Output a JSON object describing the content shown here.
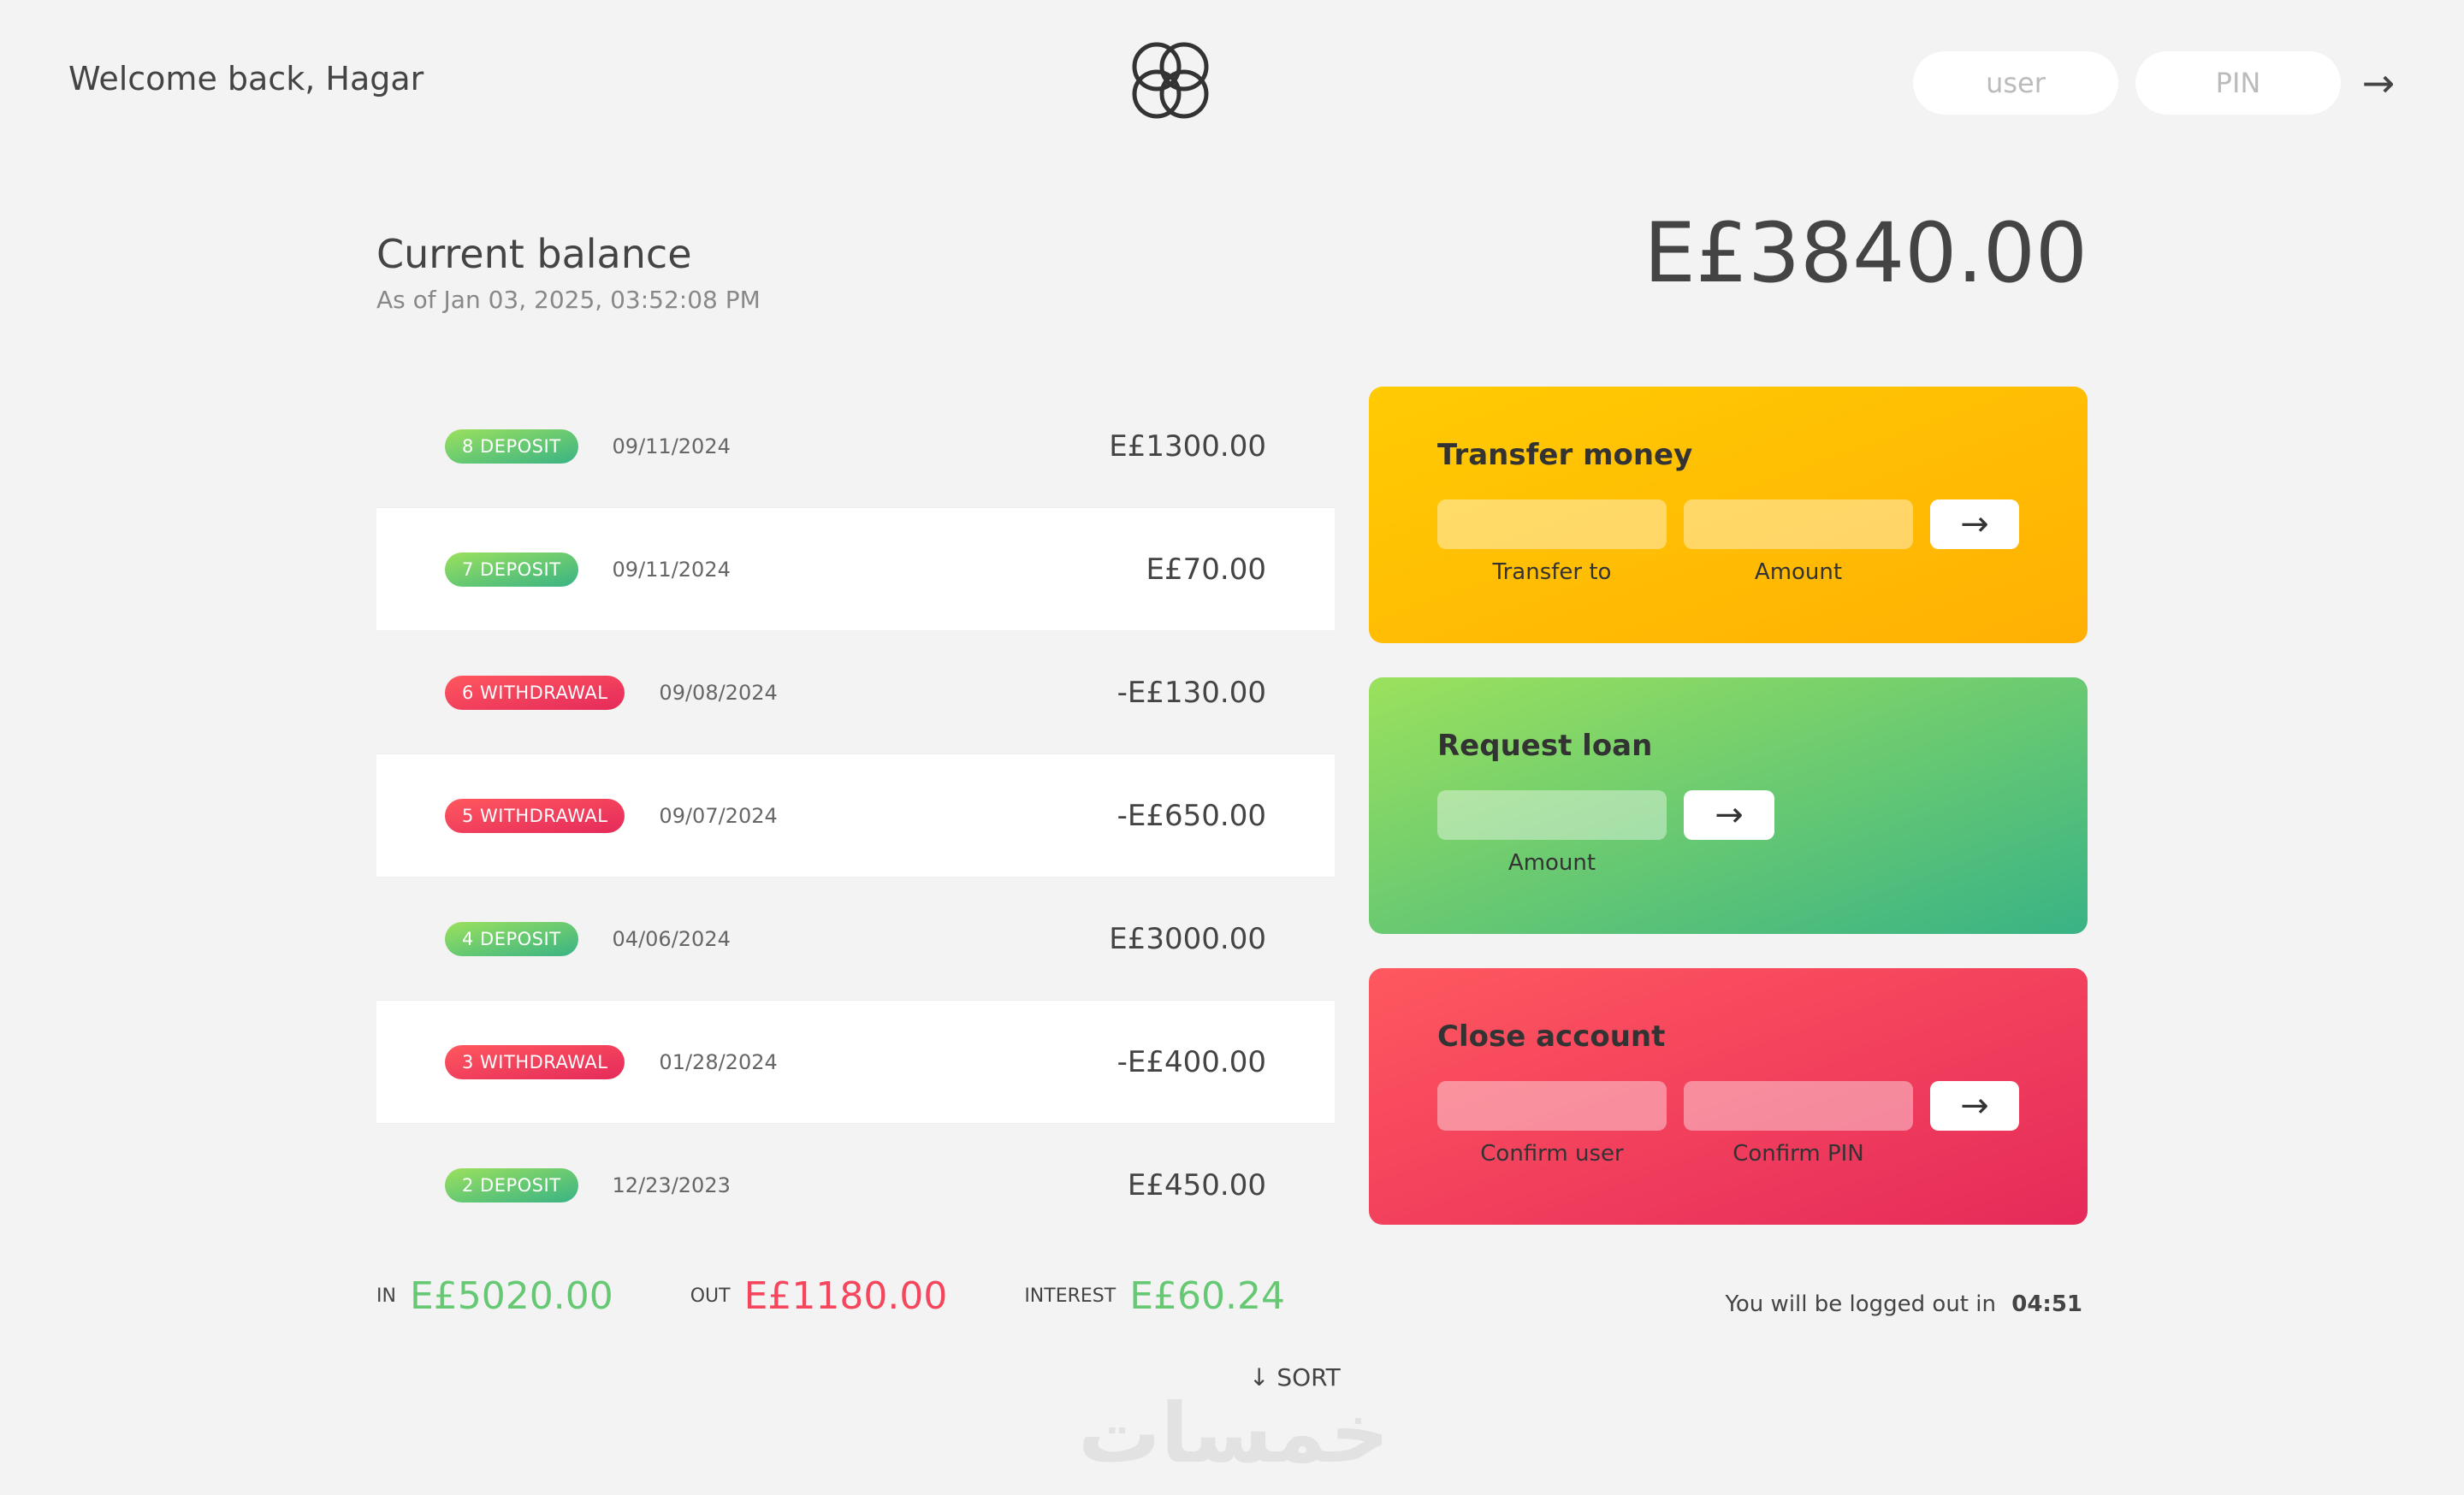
{
  "nav": {
    "welcome": "Welcome back, Hagar",
    "login_user_placeholder": "user",
    "login_pin_placeholder": "PIN",
    "login_button": "→"
  },
  "balance": {
    "label": "Current balance",
    "date": "As of Jan 03, 2025, 03:52:08 PM",
    "value": "E£3840.00"
  },
  "movements": [
    {
      "badge": "8 deposit",
      "type": "deposit",
      "date": "09/11/2024",
      "value": "E£1300.00"
    },
    {
      "badge": "7 deposit",
      "type": "deposit",
      "date": "09/11/2024",
      "value": "E£70.00"
    },
    {
      "badge": "6 withdrawal",
      "type": "withdrawal",
      "date": "09/08/2024",
      "value": "-E£130.00"
    },
    {
      "badge": "5 withdrawal",
      "type": "withdrawal",
      "date": "09/07/2024",
      "value": "-E£650.00"
    },
    {
      "badge": "4 deposit",
      "type": "deposit",
      "date": "04/06/2024",
      "value": "E£3000.00"
    },
    {
      "badge": "3 withdrawal",
      "type": "withdrawal",
      "date": "01/28/2024",
      "value": "-E£400.00"
    },
    {
      "badge": "2 deposit",
      "type": "deposit",
      "date": "12/23/2023",
      "value": "E£450.00"
    }
  ],
  "operations": {
    "transfer": {
      "title": "Transfer money",
      "label_to": "Transfer to",
      "label_amount": "Amount",
      "button": "→"
    },
    "loan": {
      "title": "Request loan",
      "label_amount": "Amount",
      "button": "→"
    },
    "close": {
      "title": "Close account",
      "label_user": "Confirm user",
      "label_pin": "Confirm PIN",
      "button": "→"
    }
  },
  "summary": {
    "in_label": "In",
    "in_value": "E£5020.00",
    "out_label": "Out",
    "out_value": "E£1180.00",
    "interest_label": "Interest",
    "interest_value": "E£60.24",
    "sort_button": "↓ SORT"
  },
  "logout": {
    "text": "You will be logged out in",
    "timer": "04:51"
  },
  "watermark": "خمسات",
  "colors": {
    "deposit": "#66c873",
    "withdrawal": "#f5465d",
    "transfer_card": "#ffb003",
    "loan_card": "#39b385",
    "close_card": "#e52a5a"
  }
}
